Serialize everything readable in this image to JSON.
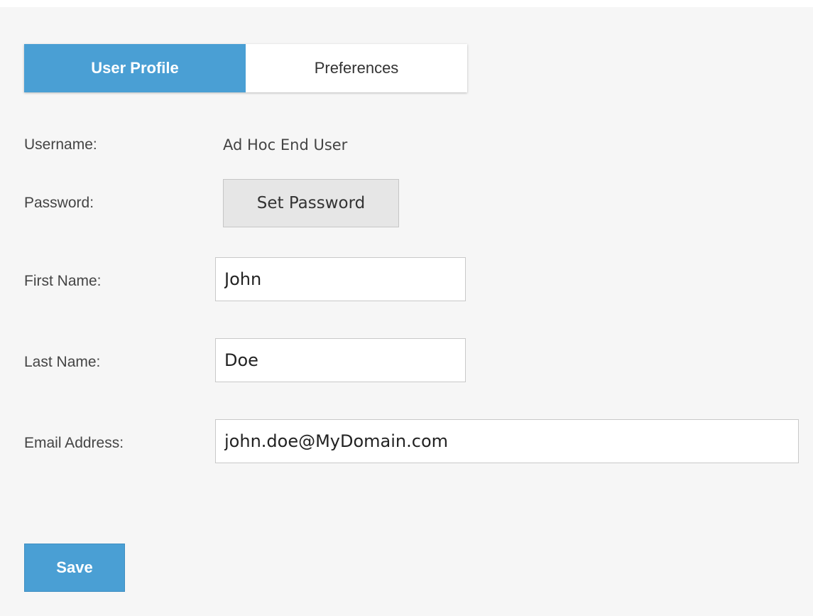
{
  "tabs": [
    {
      "label": "User Profile",
      "active": true
    },
    {
      "label": "Preferences",
      "active": false
    }
  ],
  "form": {
    "username_label": "Username:",
    "username_value": "Ad Hoc End User",
    "password_label": "Password:",
    "set_password_label": "Set Password",
    "first_name_label": "First Name:",
    "first_name_value": "John",
    "last_name_label": "Last Name:",
    "last_name_value": "Doe",
    "email_label": "Email Address:",
    "email_value": "john.doe@MyDomain.com"
  },
  "actions": {
    "save_label": "Save"
  },
  "colors": {
    "accent": "#4a9fd4",
    "panel_background": "#f6f6f6",
    "secondary_button": "#e6e6e6"
  }
}
